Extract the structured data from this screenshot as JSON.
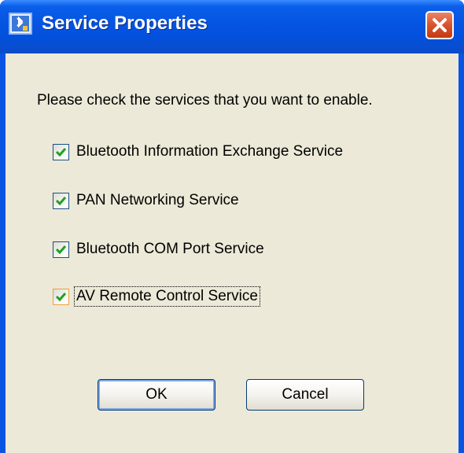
{
  "window": {
    "title": "Service Properties",
    "icon": "bluetooth-app-icon",
    "close_icon": "close-icon"
  },
  "prompt": "Please check the services that you want to enable.",
  "services": [
    {
      "label": "Bluetooth Information Exchange Service",
      "checked": true
    },
    {
      "label": "PAN Networking Service",
      "checked": true
    },
    {
      "label": "Bluetooth COM Port Service",
      "checked": true
    },
    {
      "label": "AV Remote Control Service",
      "checked": true,
      "focused": true
    }
  ],
  "buttons": {
    "ok": "OK",
    "cancel": "Cancel"
  },
  "colors": {
    "titlebar": "#0554e2",
    "client_bg": "#ece9d8",
    "check_green": "#21a121",
    "close_red": "#d8522b"
  }
}
